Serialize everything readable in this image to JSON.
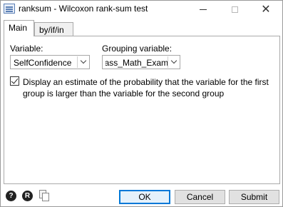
{
  "window": {
    "title": "ranksum - Wilcoxon rank-sum test",
    "minimize_icon": "minimize-icon",
    "maximize_icon": "maximize-icon",
    "close_glyph": "✕"
  },
  "tabs": [
    {
      "label": "Main",
      "selected": true
    },
    {
      "label": "by/if/in",
      "selected": false
    }
  ],
  "main": {
    "variable": {
      "label": "Variable:",
      "value": "SelfConfidence"
    },
    "grouping": {
      "label": "Grouping variable:",
      "value": "Pass_Math_Exam"
    },
    "estimate": {
      "checked": true,
      "text": "Display an estimate of the probability that the variable for the first group is larger than the variable for the second group"
    }
  },
  "footer": {
    "help_glyph": "?",
    "reset_glyph": "R",
    "copy_icon": "copy-command-icon",
    "ok_label": "OK",
    "cancel_label": "Cancel",
    "submit_label": "Submit"
  },
  "colors": {
    "focus_border": "#0078d7",
    "button_bg": "#e1e1e1"
  }
}
